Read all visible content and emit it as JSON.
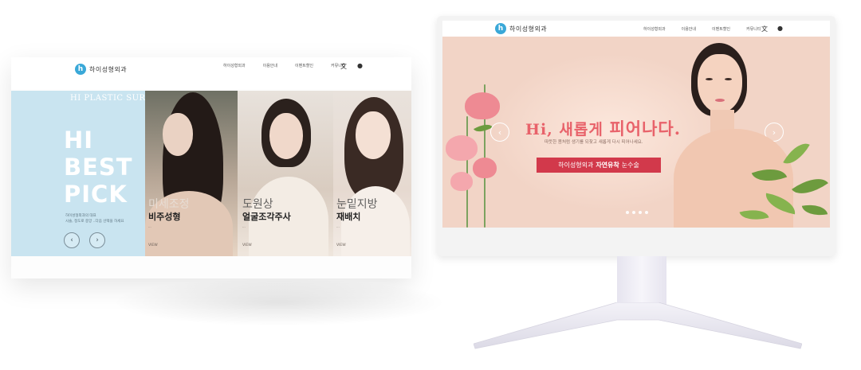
{
  "left_site": {
    "logo_text": "하이성형외과",
    "menu": [
      "하이성형외과",
      "이용안내",
      "이벤트할인",
      "커뮤니티"
    ],
    "hero_tag": "HI PLASTIC SURGERY",
    "hero_lines": [
      "HI",
      "BEST",
      "PICK"
    ],
    "hero_sub": [
      "하이성형외과의 대표",
      "시술, 정도로 중앙 ..다음 선택을 하세요"
    ],
    "cards": [
      {
        "ko_title": "미세조정",
        "title": "비주성형",
        "desc": "...",
        "view": "VIEW"
      },
      {
        "ko_title": "도원상",
        "title": "얼굴조각주사",
        "desc": "...",
        "view": "VIEW"
      },
      {
        "ko_title": "눈밑지방",
        "title": "재배치",
        "desc": "...",
        "view": "VIEW"
      }
    ]
  },
  "right_site": {
    "logo_text": "하이성형외과",
    "menu": [
      "하이성형외과",
      "이용안내",
      "이벤트할인",
      "커뮤니티"
    ],
    "headline_prefix": "Hi, 새롭게 ",
    "headline_emph": "피어나다.",
    "subline": "따뜻한 봄처럼 생기를 되찾고 새롭게 다시 피어나세요.",
    "cta_prefix": "하이성형외과",
    "cta_emph": "자연유착",
    "cta_suffix": "눈수술",
    "dots": 4
  }
}
